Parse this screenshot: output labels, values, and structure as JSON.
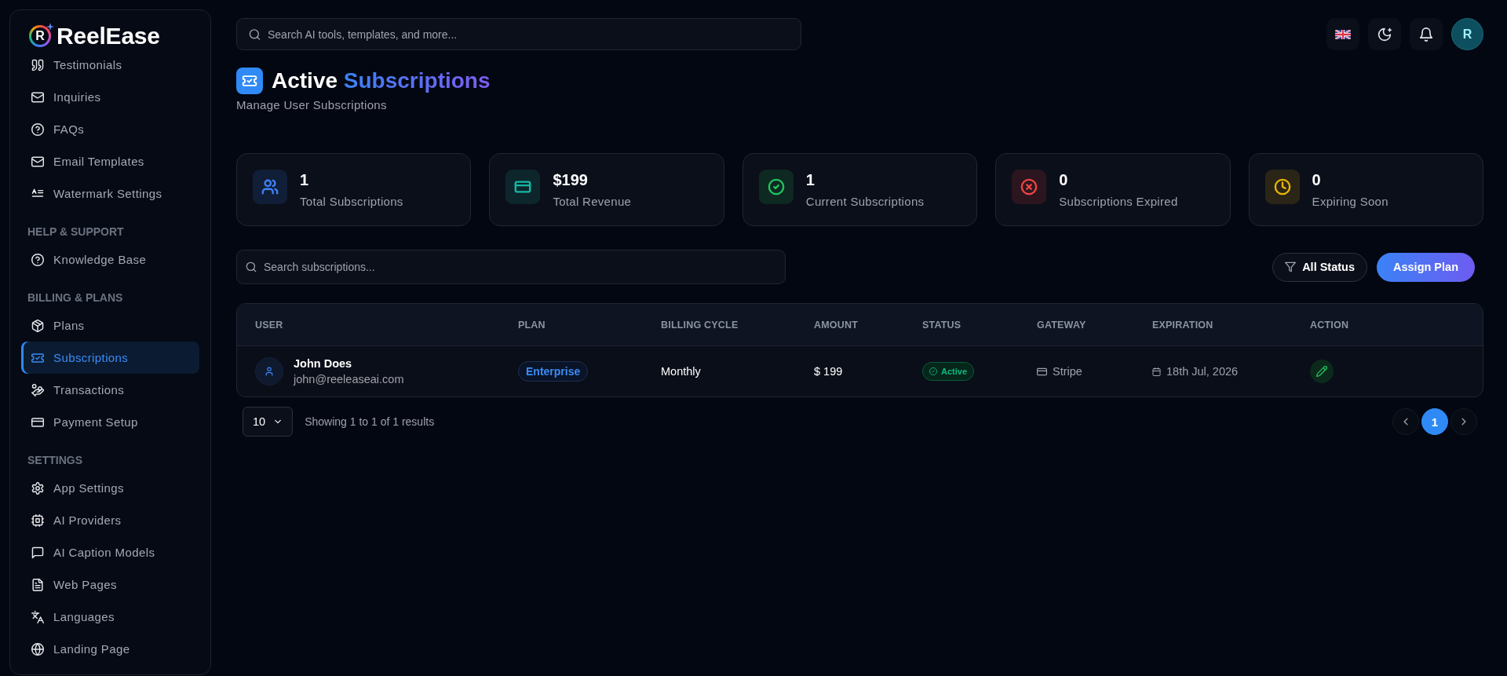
{
  "sidebar": {
    "logo": {
      "mark": "R",
      "name": "ReelEase"
    },
    "sections": [
      {
        "items": [
          {
            "label": "Testimonials",
            "selected": false
          },
          {
            "label": "Inquiries",
            "selected": false
          },
          {
            "label": "FAQs",
            "selected": false
          },
          {
            "label": "Email Templates",
            "selected": false
          },
          {
            "label": "Watermark Settings",
            "selected": false
          }
        ]
      },
      {
        "heading": "HELP & SUPPORT",
        "items": [
          {
            "label": "Knowledge Base",
            "selected": false
          }
        ]
      },
      {
        "heading": "BILLING & PLANS",
        "items": [
          {
            "label": "Plans",
            "selected": false
          },
          {
            "label": "Subscriptions",
            "selected": true
          },
          {
            "label": "Transactions",
            "selected": false
          },
          {
            "label": "Payment Setup",
            "selected": false
          }
        ]
      },
      {
        "heading": "SETTINGS",
        "items": [
          {
            "label": "App Settings",
            "selected": false
          },
          {
            "label": "AI Providers",
            "selected": false
          },
          {
            "label": "AI Caption Models",
            "selected": false
          },
          {
            "label": "Web Pages",
            "selected": false
          },
          {
            "label": "Languages",
            "selected": false
          },
          {
            "label": "Landing Page",
            "selected": false
          }
        ]
      }
    ]
  },
  "header": {
    "search": {
      "placeholder": "Search AI tools, templates, and more..."
    },
    "avatar": "R"
  },
  "page": {
    "title": {
      "text": "Active",
      "accent": "Subscriptions"
    },
    "subtitle": "Manage User Subscriptions"
  },
  "stats": [
    {
      "kind": "total",
      "value": "1",
      "label": "Total Subscriptions",
      "color": "#3b82f6"
    },
    {
      "kind": "revenue",
      "value": "$199",
      "label": "Total Revenue",
      "color": "#14b8a6"
    },
    {
      "kind": "current",
      "value": "1",
      "label": "Current Subscriptions",
      "color": "#22c55e"
    },
    {
      "kind": "expired",
      "value": "0",
      "label": "Subscriptions Expired",
      "color": "#ef4444"
    },
    {
      "kind": "expiring",
      "value": "0",
      "label": "Expiring Soon",
      "color": "#eab308"
    }
  ],
  "toolbar": {
    "search": {
      "placeholder": "Search subscriptions..."
    },
    "filter": "All Status",
    "action": "Assign Plan"
  },
  "table": {
    "columns": [
      "USER",
      "PLAN",
      "BILLING CYCLE",
      "AMOUNT",
      "STATUS",
      "GATEWAY",
      "EXPIRATION",
      "ACTION"
    ],
    "rows": [
      {
        "user": {
          "name": "John Does",
          "email": "john@reeleaseai.com"
        },
        "plan": "Enterprise",
        "billing_cycle": "Monthly",
        "amount": "$ 199",
        "status": "Active",
        "gateway": "Stripe",
        "expiration": "18th Jul, 2026"
      }
    ]
  },
  "pagination": {
    "page_size": "10",
    "summary": "Showing 1 to 1 of 1 results",
    "pages": [
      {
        "label": "1",
        "selected": true
      }
    ]
  }
}
